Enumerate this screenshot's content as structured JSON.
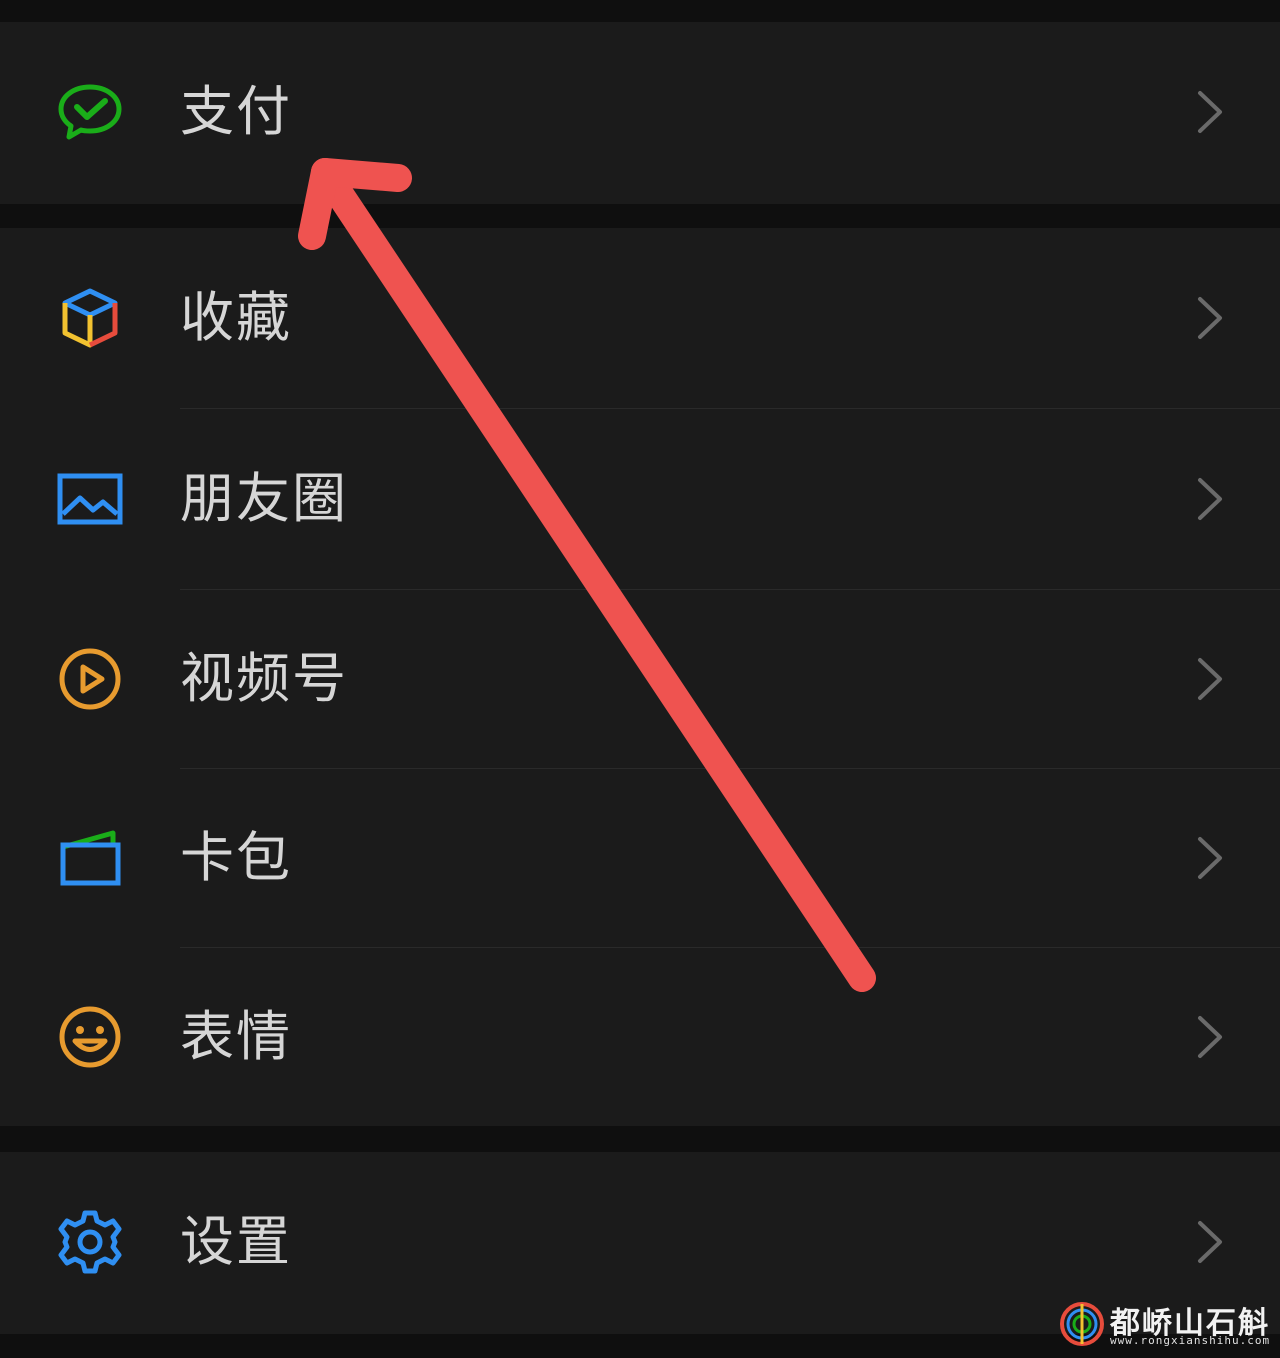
{
  "menu": {
    "items": [
      {
        "label": "支付",
        "icon": "wechat-pay-icon"
      },
      {
        "label": "收藏",
        "icon": "favorites-cube-icon"
      },
      {
        "label": "朋友圈",
        "icon": "moments-image-icon"
      },
      {
        "label": "视频号",
        "icon": "channels-play-icon"
      },
      {
        "label": "卡包",
        "icon": "card-wallet-icon"
      },
      {
        "label": "表情",
        "icon": "sticker-smile-icon"
      },
      {
        "label": "设置",
        "icon": "settings-gear-icon"
      }
    ]
  },
  "annotation": {
    "type": "arrow",
    "color": "#ef5350",
    "points_to": "支付"
  },
  "watermark": {
    "text": "都峤山石斛",
    "url": "www.rongxianshihu.com"
  },
  "colors": {
    "background": "#0f0f0f",
    "row": "#1b1b1b",
    "text": "#d6d6d6",
    "pay_green": "#1aad19",
    "moments_blue": "#2f8ff2",
    "channels_orange": "#e79b2f",
    "settings_blue": "#2f8ff2"
  }
}
